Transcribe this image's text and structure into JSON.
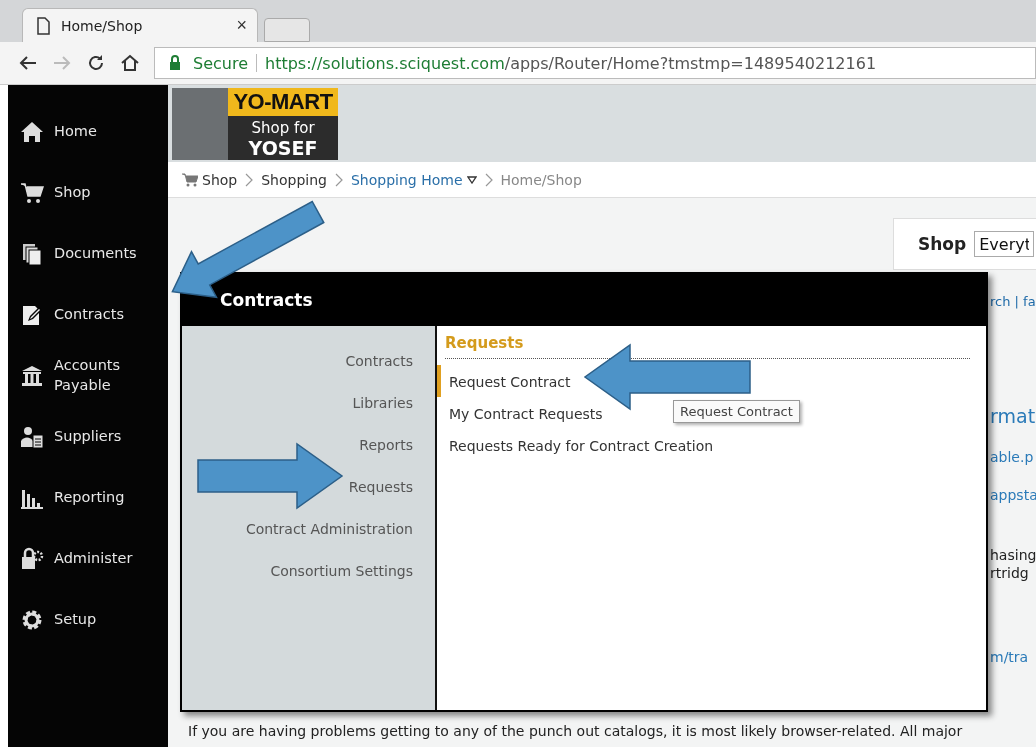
{
  "browser": {
    "tab": {
      "title": "Home/Shop",
      "close": "×"
    },
    "address": {
      "secure_label": "Secure",
      "url_host": "https://solutions.sciquest.com",
      "url_path": "/apps/Router/Home?tmstmp=1489540212161"
    }
  },
  "sidebar": {
    "items": [
      {
        "label": "Home",
        "kind": "home"
      },
      {
        "label": "Shop",
        "kind": "cart"
      },
      {
        "label": "Documents",
        "kind": "documents"
      },
      {
        "label": "Contracts",
        "kind": "contract"
      },
      {
        "label": "Accounts Payable",
        "kind": "bank"
      },
      {
        "label": "Suppliers",
        "kind": "supplier"
      },
      {
        "label": "Reporting",
        "kind": "chart"
      },
      {
        "label": "Administer",
        "kind": "lock"
      },
      {
        "label": "Setup",
        "kind": "gear"
      }
    ]
  },
  "logo": {
    "title": "YO-MART",
    "line1": "Shop for",
    "line2": "YOSEF"
  },
  "breadcrumb": [
    {
      "label": "Shop",
      "kind": "root"
    },
    {
      "label": "Shopping",
      "kind": "plain"
    },
    {
      "label": "Shopping Home",
      "kind": "dropdown"
    },
    {
      "label": "Home/Shop",
      "kind": "current"
    }
  ],
  "shop_search": {
    "label": "Shop",
    "value": "Everyt"
  },
  "page_fragments": [
    {
      "text": "rch | fa",
      "kind": "small"
    },
    {
      "text": "rmat",
      "kind": "heading"
    },
    {
      "text": "able.p",
      "kind": "link"
    },
    {
      "text": "appsta",
      "kind": "link"
    },
    {
      "text": "hasing",
      "kind": "text"
    },
    {
      "text": "rtridg",
      "kind": "text"
    },
    {
      "text": "m/tra",
      "kind": "link"
    }
  ],
  "footer_text": "If you are having problems getting to any of the punch out catalogs, it is most likely browser-related. All major",
  "contracts_menu": {
    "title": "Contracts",
    "sections": [
      "Contracts",
      "Libraries",
      "Reports",
      "Requests",
      "Contract Administration",
      "Consortium Settings"
    ],
    "group_title": "Requests",
    "items": [
      {
        "label": "Request Contract",
        "selected": true
      },
      {
        "label": "My Contract Requests",
        "selected": false
      },
      {
        "label": "Requests Ready for Contract Creation",
        "selected": false
      }
    ],
    "tooltip": "Request Contract"
  }
}
